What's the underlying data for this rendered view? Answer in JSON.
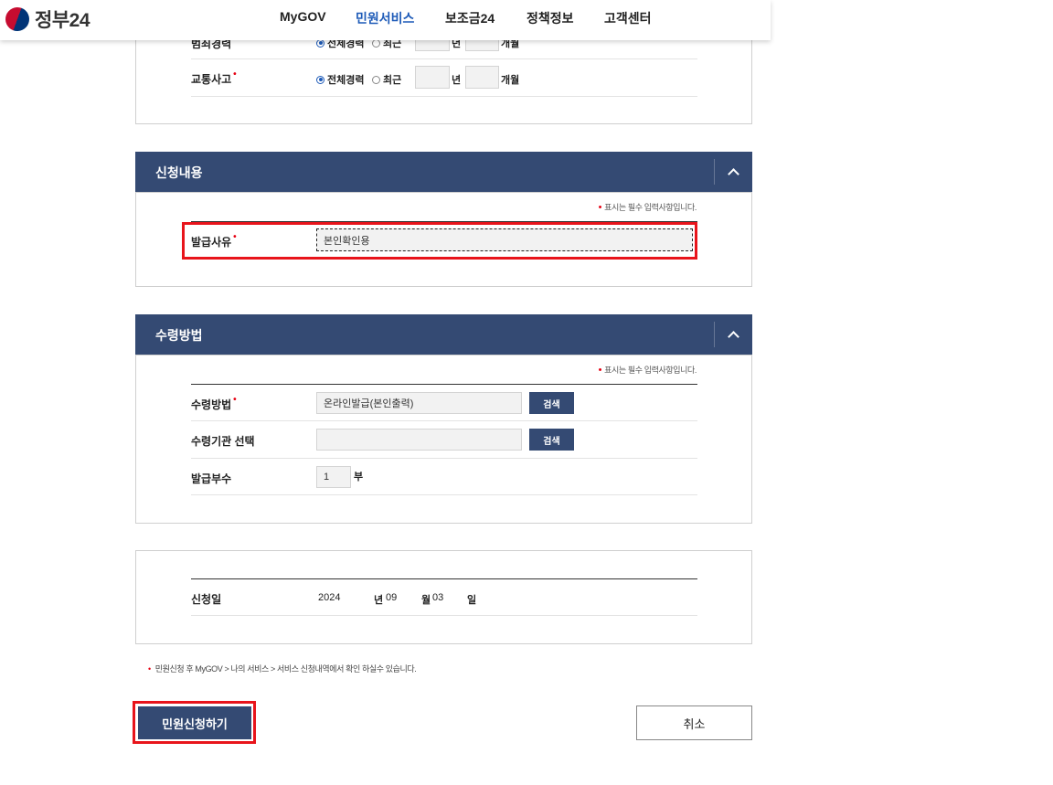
{
  "header": {
    "logo_text": "정부24",
    "nav": [
      "MyGOV",
      "민원서비스",
      "보조금24",
      "정책정보",
      "고객센터"
    ],
    "active_nav": "민원서비스"
  },
  "history_panel": {
    "row_partial": {
      "label": "범죄경력",
      "radio_all": "전체경력",
      "radio_recent": "최근",
      "unit_year": "년",
      "unit_month": "개월"
    },
    "row_traffic": {
      "label": "교통사고",
      "radio_all": "전체경력",
      "radio_recent": "최근",
      "unit_year": "년",
      "unit_month": "개월"
    }
  },
  "application": {
    "title": "신청내용",
    "required_note": "표시는 필수 입력사항입니다.",
    "reason_label": "발급사유",
    "reason_value": "본인확인용"
  },
  "receipt": {
    "title": "수령방법",
    "required_note": "표시는 필수 입력사항입니다.",
    "method_label": "수령방법",
    "method_value": "온라인발급(본인출력)",
    "search_label": "검색",
    "agency_label": "수령기관 선택",
    "agency_value": "",
    "copies_label": "발급부수",
    "copies_value": "1",
    "copies_unit": "부"
  },
  "date_panel": {
    "label": "신청일",
    "year": "2024",
    "year_unit": "년",
    "month": "09",
    "month_unit": "월",
    "day": "03",
    "day_unit": "일"
  },
  "footer": {
    "note": "민원신청 후 MyGOV > 나의 서비스 > 서비스 신청내역에서 확인 하실수 있습니다.",
    "apply_button": "민원신청하기",
    "cancel_button": "취소"
  },
  "colors": {
    "primary": "#344a73",
    "highlight": "#e8141b",
    "required": "#e60012",
    "active_nav": "#1e5bb8"
  }
}
